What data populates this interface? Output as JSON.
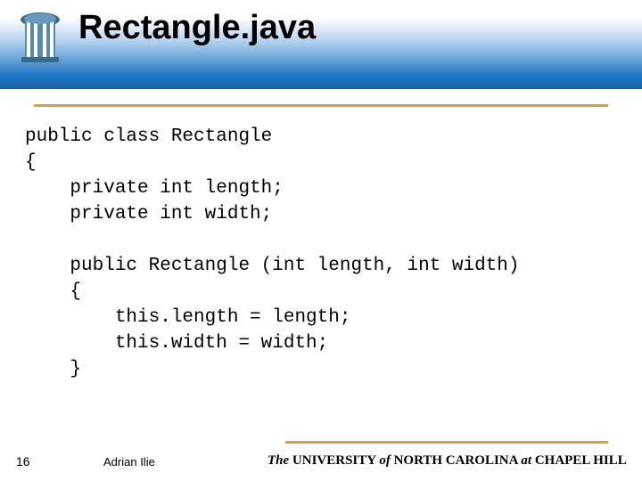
{
  "slide": {
    "title": "Rectangle.java",
    "page_number": "16",
    "author": "Adrian Ilie",
    "affiliation": {
      "the": "The",
      "university": " UNIVERSITY ",
      "of": "of",
      "nc": " NORTH CAROLINA ",
      "at": "at",
      "ch": " CHAPEL HILL"
    }
  },
  "code": {
    "line1": "public class Rectangle",
    "line2": "{",
    "line3": "    private int length;",
    "line4": "    private int width;",
    "blank1": "",
    "line5": "    public Rectangle (int length, int width)",
    "line6": "    {",
    "line7": "        this.length = length;",
    "line8": "        this.width = width;",
    "line9": "    }"
  }
}
